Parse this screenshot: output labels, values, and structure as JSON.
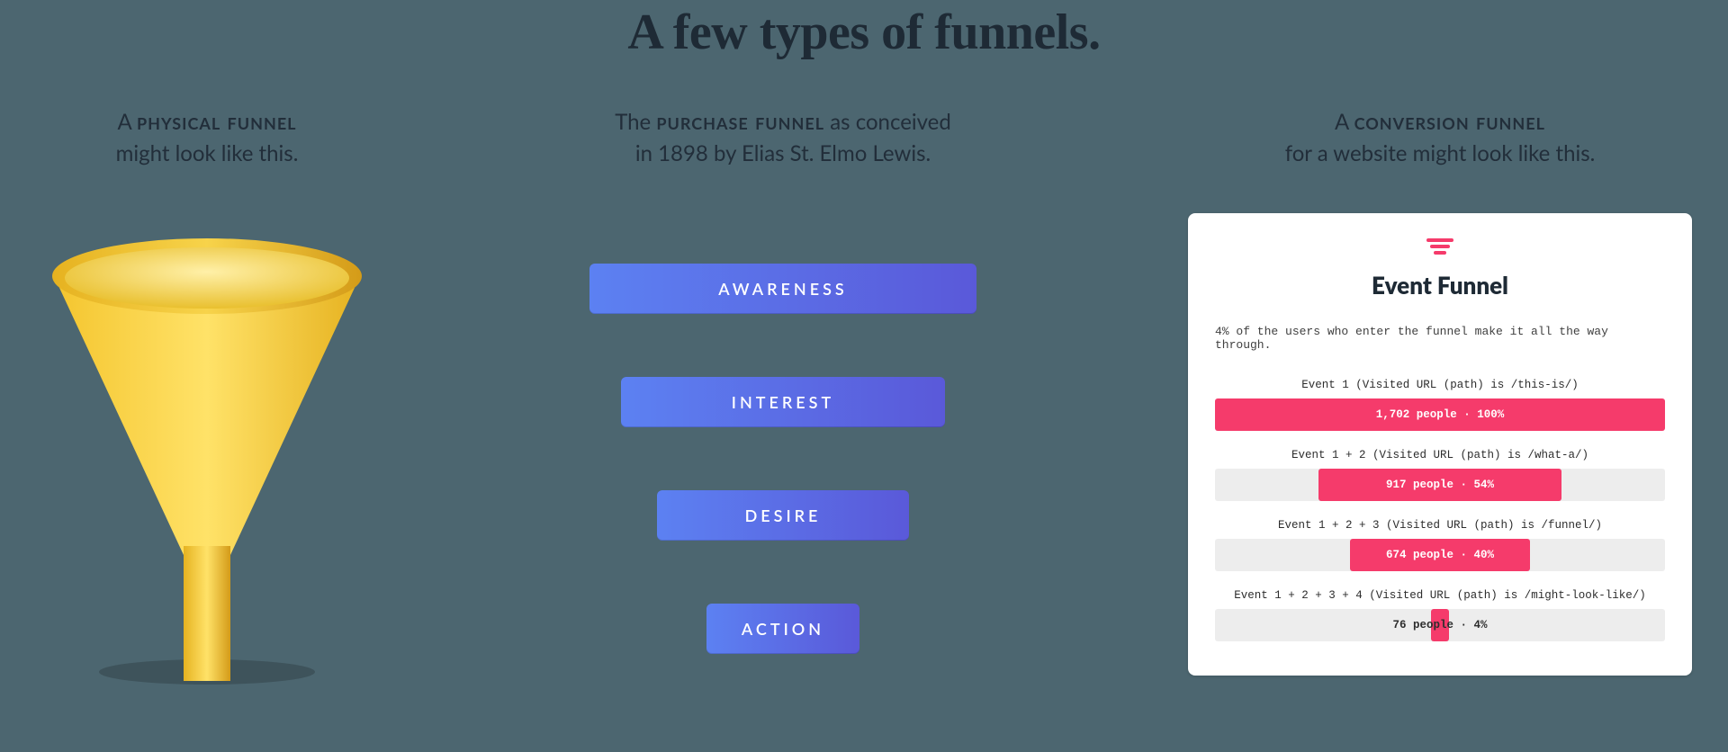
{
  "title": "A few types of funnels.",
  "physical": {
    "caption_prefix": "A ",
    "caption_term": "physical funnel",
    "caption_suffix": "might look like this."
  },
  "aida": {
    "caption_prefix": "The ",
    "caption_term": "purchase funnel",
    "caption_mid": " as conceived",
    "caption_suffix": "in 1898 by Elias St. Elmo Lewis.",
    "stages": [
      "AWARENESS",
      "INTEREST",
      "DESIRE",
      "ACTION"
    ]
  },
  "conversion": {
    "caption_prefix": "A ",
    "caption_term": "conversion funnel",
    "caption_suffix": "for a website might look like this.",
    "card_title": "Event Funnel",
    "card_subtitle": "4% of the users who enter the funnel make it all the way through.",
    "events": [
      {
        "label": "Event 1 (Visited URL (path) is /this-is/)",
        "people": "1,702 people",
        "pct_label": "100%",
        "pct": 100
      },
      {
        "label": "Event 1 + 2 (Visited URL (path) is /what-a/)",
        "people": "917 people",
        "pct_label": "54%",
        "pct": 54
      },
      {
        "label": "Event 1 + 2 + 3 (Visited URL (path) is /funnel/)",
        "people": "674 people",
        "pct_label": "40%",
        "pct": 40
      },
      {
        "label": "Event 1 + 2 + 3 + 4 (Visited URL (path) is /might-look-like/)",
        "people": "76 people",
        "pct_label": "4%",
        "pct": 4
      }
    ]
  },
  "chart_data": {
    "type": "bar",
    "title": "Event Funnel",
    "categories": [
      "Event 1 (Visited URL (path) is /this-is/)",
      "Event 1 + 2 (Visited URL (path) is /what-a/)",
      "Event 1 + 2 + 3 (Visited URL (path) is /funnel/)",
      "Event 1 + 2 + 3 + 4 (Visited URL (path) is /might-look-like/)"
    ],
    "series": [
      {
        "name": "people",
        "values": [
          1702,
          917,
          674,
          76
        ]
      },
      {
        "name": "percent",
        "values": [
          100,
          54,
          40,
          4
        ]
      }
    ],
    "xlabel": "",
    "ylabel": "",
    "ylim": [
      0,
      100
    ]
  }
}
